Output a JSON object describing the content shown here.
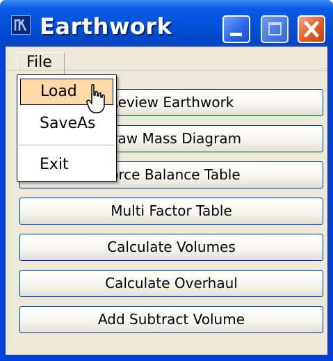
{
  "window": {
    "title": "Earthwork",
    "controls": {
      "minimize": "minimize-icon",
      "maximize": "maximize-icon",
      "close": "close-icon"
    }
  },
  "menubar": {
    "file_label": "File"
  },
  "file_menu": {
    "items": [
      {
        "label": "Load",
        "highlighted": true
      },
      {
        "label": "SaveAs"
      },
      {
        "label": "Exit"
      }
    ]
  },
  "buttons": [
    {
      "label": "Review Earthwork"
    },
    {
      "label": "Draw Mass Diagram"
    },
    {
      "label": "Force Balance Table"
    },
    {
      "label": "Multi Factor Table"
    },
    {
      "label": "Calculate Volumes"
    },
    {
      "label": "Calculate Overhaul"
    },
    {
      "label": "Add Subtract Volume"
    }
  ],
  "colors": {
    "titlebar": "#0152d9",
    "menu_highlight": "#fcd9a6",
    "client_bg": "#ece9d8"
  }
}
